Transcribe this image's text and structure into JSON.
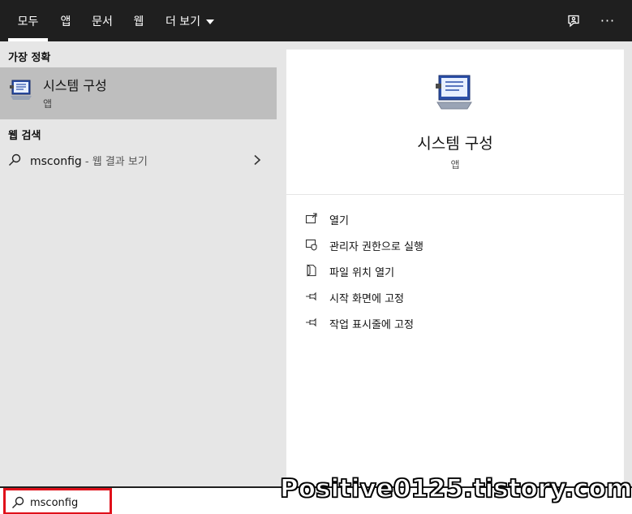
{
  "tabs": [
    {
      "label": "모두",
      "active": true
    },
    {
      "label": "앱"
    },
    {
      "label": "문서"
    },
    {
      "label": "웹"
    },
    {
      "label": "더 보기"
    }
  ],
  "top_icons": [
    "feedback-icon",
    "more-icon"
  ],
  "more_dots": "···",
  "left": {
    "best_match_title": "가장 정확",
    "best_match": {
      "name": "시스템 구성",
      "type": "앱",
      "icon": "system-config-icon"
    },
    "web_title": "웹 검색",
    "web_result": {
      "query": "msconfig",
      "suffix": " - 웹 결과 보기"
    }
  },
  "right": {
    "app_name": "시스템 구성",
    "app_type": "앱",
    "actions": [
      {
        "label": "열기",
        "icon": "open-icon"
      },
      {
        "label": "관리자 권한으로 실행",
        "icon": "admin-shield-icon"
      },
      {
        "label": "파일 위치 열기",
        "icon": "file-location-icon"
      },
      {
        "label": "시작 화면에 고정",
        "icon": "pin-start-icon"
      },
      {
        "label": "작업 표시줄에 고정",
        "icon": "pin-taskbar-icon"
      }
    ]
  },
  "search": {
    "value": "msconfig"
  },
  "watermark": "Positive0125.tistory.com",
  "colors": {
    "topbar": "#1f1f1f",
    "selected": "#bebebe",
    "highlight_box": "#e0101a"
  }
}
